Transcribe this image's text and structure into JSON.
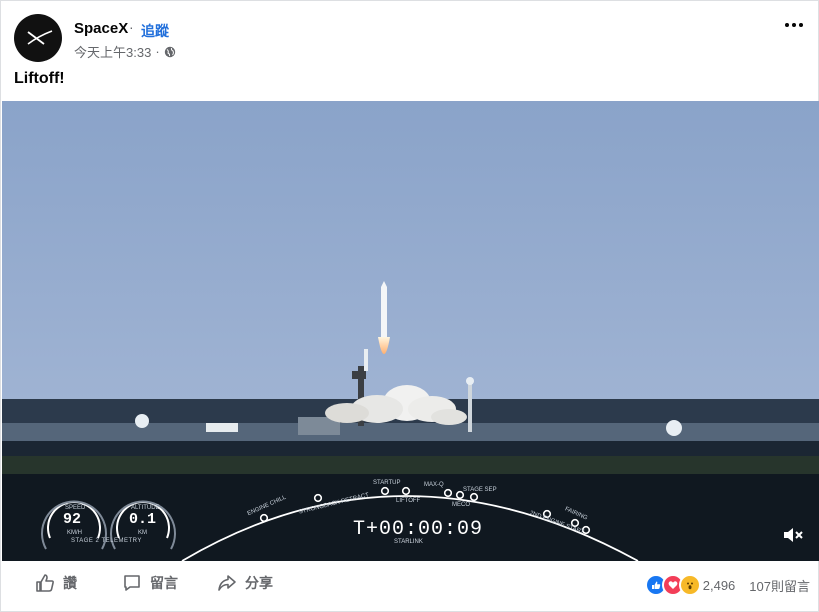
{
  "post": {
    "author": "SpaceX",
    "separator": "·",
    "follow_label": "追蹤",
    "timestamp": "今天上午3:33",
    "meta_separator": "·",
    "caption": "Liftoff!",
    "privacy_icon": "globe-icon",
    "menu_icon": "more-icon"
  },
  "video": {
    "timer": "T+00:00:09",
    "timer_sub": "STARLINK",
    "gauge_speed": {
      "value": "92",
      "label_top": "SPEED",
      "label_bottom": "KM/H"
    },
    "gauge_altitude": {
      "value": "0.1",
      "label_top": "ALTITUDE",
      "label_bottom": "KM"
    },
    "telemetry_label": "STAGE 2 TELEMETRY",
    "events_left": [
      "ENGINE CHILL",
      "STRONGBACK RETRACT",
      "STARTUP",
      "LIFTOFF"
    ],
    "events_right": [
      "MAX-Q",
      "MECO",
      "STAGE SEP",
      "2ND ENGINE START",
      "FAIRING"
    ],
    "mute_icon": "volume-muted-icon"
  },
  "actions": {
    "like_label": "讚",
    "comment_label": "留言",
    "share_label": "分享"
  },
  "reactions": {
    "count": "2,496",
    "comments": "107則留言",
    "types": [
      "like",
      "love",
      "wow"
    ],
    "colors": {
      "like": "#1877f2",
      "love": "#f33e58",
      "wow": "#f7b928"
    }
  }
}
